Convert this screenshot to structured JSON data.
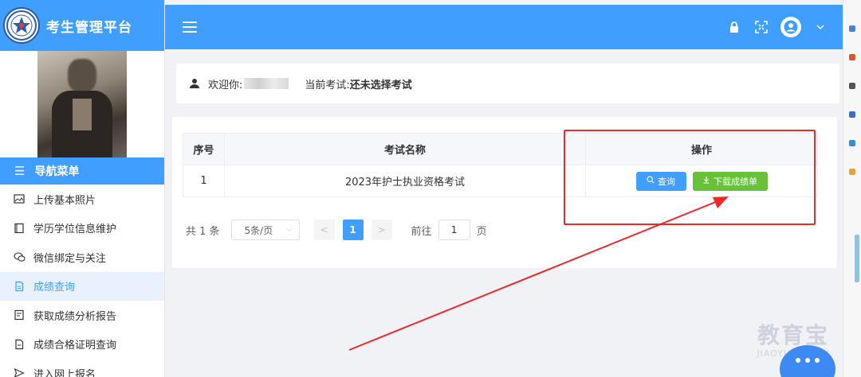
{
  "brand": {
    "title": "考生管理平台"
  },
  "nav": {
    "header": "导航菜单",
    "items": [
      {
        "label": "上传基本照片",
        "icon": "image-icon"
      },
      {
        "label": "学历学位信息维护",
        "icon": "book-icon"
      },
      {
        "label": "微信绑定与关注",
        "icon": "wechat-icon"
      },
      {
        "label": "成绩查询",
        "icon": "document-icon",
        "active": true
      },
      {
        "label": "获取成绩分析报告",
        "icon": "report-icon"
      },
      {
        "label": "成绩合格证明查询",
        "icon": "certificate-icon"
      },
      {
        "label": "进入网上报名",
        "icon": "send-icon"
      }
    ]
  },
  "header": {
    "icons": [
      "menu-icon",
      "lock-icon",
      "fullscreen-icon",
      "user-avatar-icon",
      "chevron-down-icon"
    ]
  },
  "welcome": {
    "greeting": "欢迎你:",
    "exam_label": "当前考试:",
    "exam_value": "还未选择考试"
  },
  "table": {
    "columns": [
      "序号",
      "考试名称",
      "操作"
    ],
    "rows": [
      {
        "index": "1",
        "name": "2023年护士执业资格考试"
      }
    ],
    "actions": {
      "query": "查询",
      "download": "下载成绩单"
    }
  },
  "pagination": {
    "total": "共 1 条",
    "page_size": "5条/页",
    "prev": "<",
    "current": "1",
    "next": ">",
    "goto_prefix": "前往",
    "goto_value": "1",
    "goto_suffix": "页"
  },
  "watermark": {
    "big": "教育宝",
    "small": "JIAOYUBAO.CN"
  },
  "colors": {
    "primary": "#409eff",
    "success": "#67c23a",
    "annotation": "#ec2a2a"
  }
}
